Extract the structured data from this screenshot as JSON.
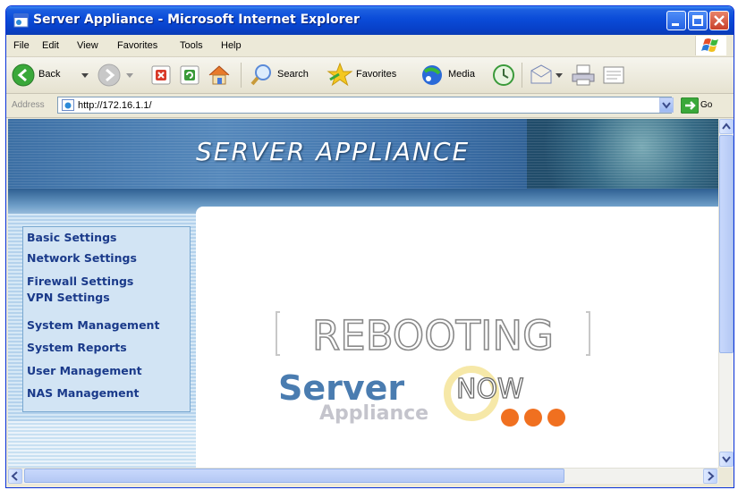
{
  "window": {
    "title": "Server Appliance - Microsoft Internet Explorer"
  },
  "menu": {
    "items": [
      {
        "label": "File"
      },
      {
        "label": "Edit"
      },
      {
        "label": "View"
      },
      {
        "label": "Favorites"
      },
      {
        "label": "Tools"
      },
      {
        "label": "Help"
      }
    ]
  },
  "toolbar": {
    "back_label": "Back",
    "search_label": "Search",
    "favorites_label": "Favorites",
    "media_label": "Media"
  },
  "address": {
    "label": "Address",
    "url": "http://172.16.1.1/",
    "go_label": "Go"
  },
  "page": {
    "banner_title": "SERVER APPLIANCE",
    "nav": [
      {
        "label": "Basic Settings"
      },
      {
        "label": "Network Settings"
      },
      {
        "label": "Firewall Settings"
      },
      {
        "label": "VPN Settings"
      },
      {
        "label": "System Management"
      },
      {
        "label": "System Reports"
      },
      {
        "label": "User Management"
      },
      {
        "label": "NAS Management"
      }
    ],
    "reboot_logo": {
      "headline": "REBOOTING",
      "brand_word": "Server",
      "brand_sub": "Appliance",
      "now_word": "NOW"
    }
  },
  "colors": {
    "title_bar": "#0a4bd8",
    "nav_link": "#1a3a8a",
    "brand_blue": "#4a7cb0",
    "accent_orange": "#f07020"
  }
}
